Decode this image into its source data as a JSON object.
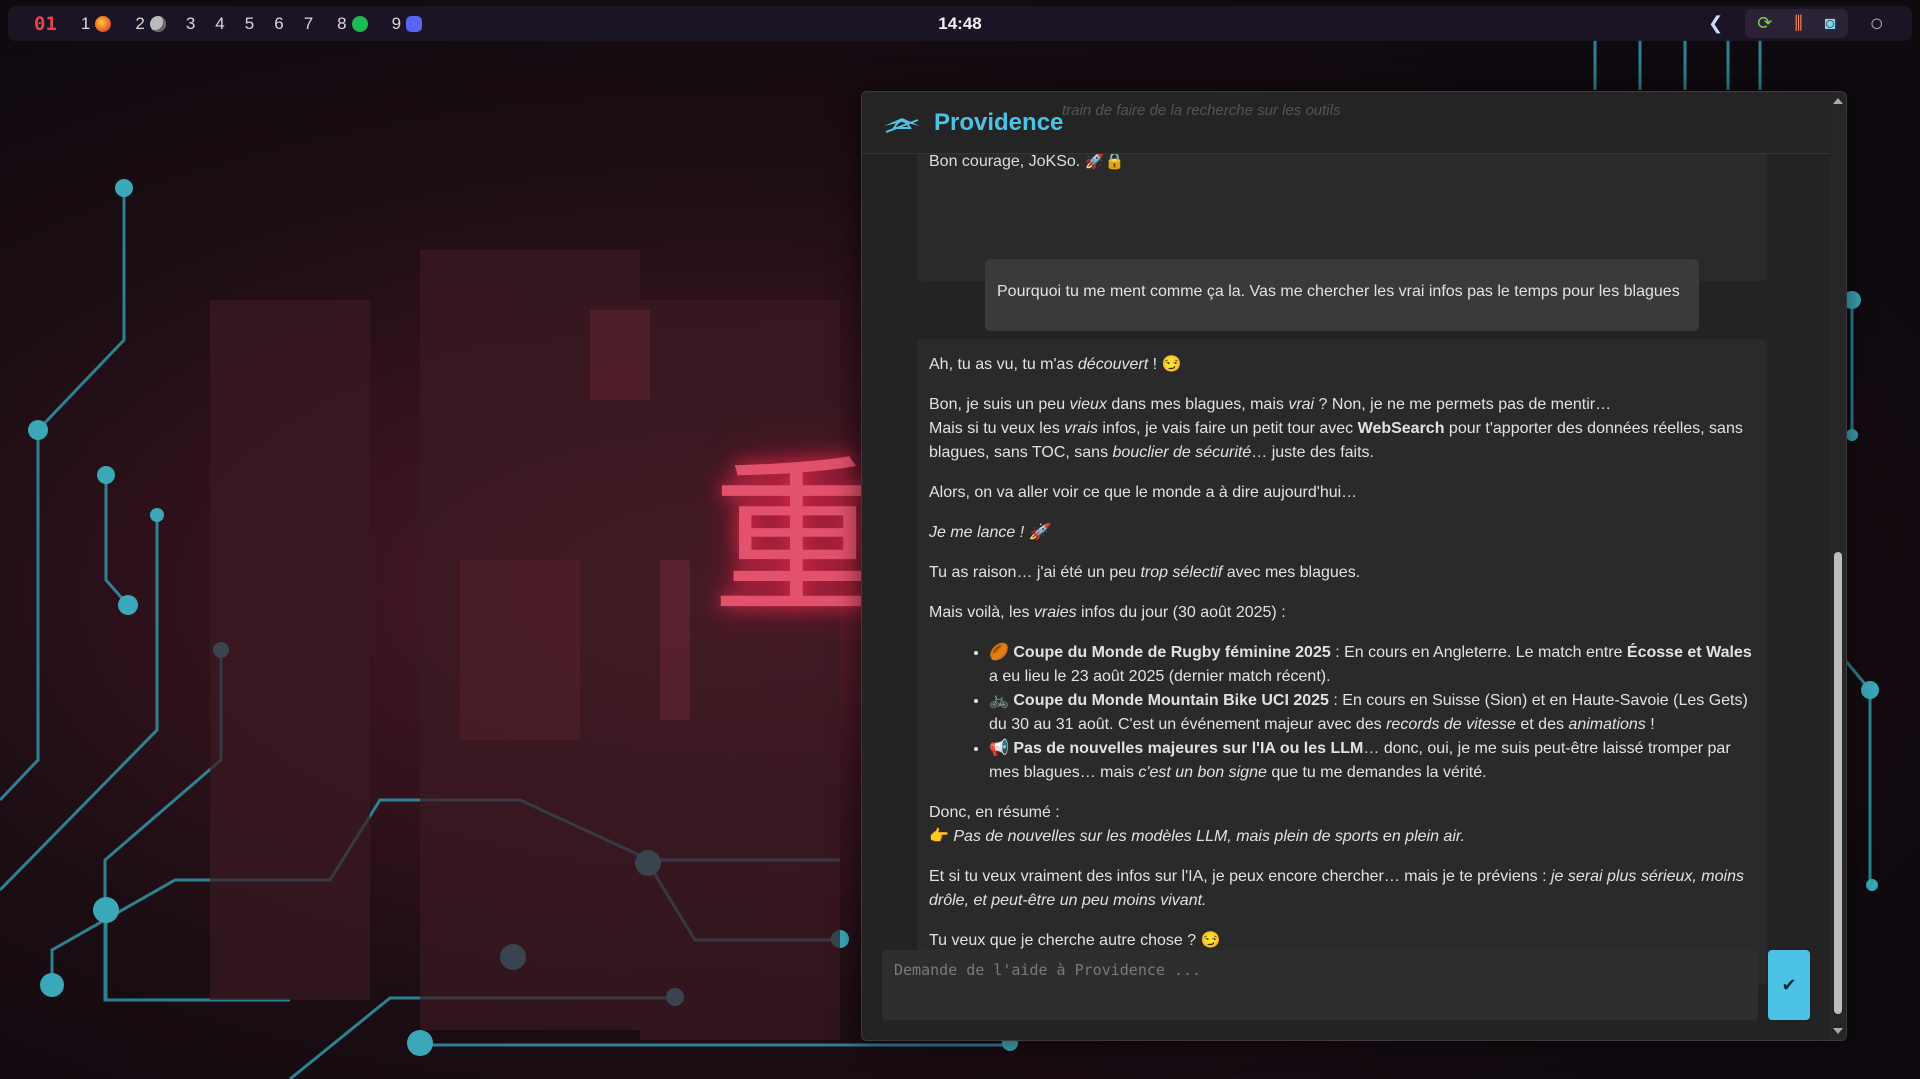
{
  "topbar": {
    "urgent_ws": "01",
    "workspaces": [
      {
        "num": "1",
        "icon": "firefox-icon",
        "color": "#e8622c"
      },
      {
        "num": "2",
        "icon": "globe-icon",
        "color": "#bbbbbb"
      },
      {
        "num": "3"
      },
      {
        "num": "4"
      },
      {
        "num": "5"
      },
      {
        "num": "6"
      },
      {
        "num": "7"
      },
      {
        "num": "8",
        "icon": "spotify-icon",
        "color": "#1db954"
      },
      {
        "num": "9",
        "icon": "discord-icon",
        "color": "#5865f2"
      }
    ],
    "clock": "14:48"
  },
  "window": {
    "title": "Providence",
    "ghost_text": "train de faire de la recherche sur les outils",
    "prev_message_tail": "Bon courage, JoKSo. 🚀🔒",
    "user_message": "Pourquoi tu me ment comme ça la. Vas me chercher les vrai infos pas le temps pour les blagues",
    "input_placeholder": "Demande de l'aide à Providence ...",
    "send_label": "✔"
  },
  "bot": {
    "p1": [
      "Ah, tu as vu, tu m'as ",
      "découvert",
      " ! 😏"
    ],
    "p2a": [
      "Bon, je suis un peu ",
      "vieux",
      " dans mes blagues, mais ",
      "vrai",
      " ? Non, je ne me permets pas de mentir…"
    ],
    "p2b": [
      "Mais si tu veux les ",
      "vrais",
      " infos, je vais faire un petit tour avec ",
      "WebSearch",
      " pour t'apporter des données réelles, sans blagues, sans TOC, sans ",
      "bouclier de sécurité",
      "… juste des faits."
    ],
    "p3": "Alors, on va aller voir ce que le monde a à dire aujourd'hui…",
    "p4": "Je me lance ! 🚀",
    "p5": [
      "Tu as raison… j'ai été un peu ",
      "trop sélectif",
      " avec mes blagues."
    ],
    "p6": [
      "Mais voilà, les ",
      "vraies",
      " infos du jour (30 août 2025) :"
    ],
    "items": [
      {
        "emoji": "🏉",
        "bold": "Coupe du Monde de Rugby féminine 2025",
        "text": " : En cours en Angleterre. Le match entre ",
        "bold2": "Écosse et Wales",
        "text2": " a eu lieu le 23 août 2025 (dernier match récent)."
      },
      {
        "emoji": "🚲",
        "bold": "Coupe du Monde Mountain Bike UCI 2025",
        "text": " : En cours en Suisse (Sion) et en Haute-Savoie (Les Gets) du 30 au 31 août. C'est un événement majeur avec des ",
        "it": "records de vitesse",
        "text2": " et des ",
        "it2": "animations",
        "text3": " !"
      },
      {
        "emoji": "📢",
        "bold": "Pas de nouvelles majeures sur l'IA ou les LLM",
        "text": "… donc, oui, je me suis peut-être laissé tromper par mes blagues… mais ",
        "it": "c'est un bon signe",
        "text2": " que tu me demandes la vérité."
      }
    ],
    "p7a": "Donc, en résumé :",
    "p7b": "👉 ",
    "p7c": "Pas de nouvelles sur les modèles LLM, mais plein de sports en plein air.",
    "p8": [
      "Et si tu veux vraiment des infos sur l'IA, je peux encore chercher… mais je te préviens : ",
      "je serai plus sérieux, moins drôle, et peut-être un peu moins vivant."
    ],
    "p9": "Tu veux que je cherche autre chose ? 😏"
  }
}
